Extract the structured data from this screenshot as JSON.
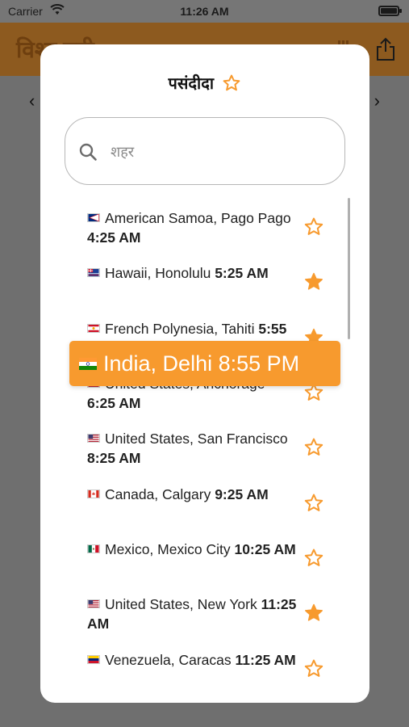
{
  "status_bar": {
    "carrier": "Carrier",
    "time": "11:26 AM"
  },
  "app_bar": {
    "title": "विश्व घड़ी"
  },
  "modal": {
    "title": "पसंदीदा",
    "search": {
      "placeholder": "शहर",
      "value": ""
    }
  },
  "cities": [
    {
      "location": "American Samoa, Pago Pago",
      "time": "4:25 AM",
      "favorite": false,
      "flag": "american-samoa"
    },
    {
      "location": "Hawaii, Honolulu",
      "time": "5:25 AM",
      "favorite": true,
      "flag": "hawaii"
    },
    {
      "location": "French Polynesia, Tahiti",
      "time": "5:55 AM",
      "favorite": true,
      "flag": "french-polynesia"
    },
    {
      "location": "United States, Anchorage",
      "time": "6:25 AM",
      "favorite": false,
      "flag": "usa"
    },
    {
      "location": "United States, San Francisco",
      "time": "8:25 AM",
      "favorite": false,
      "flag": "usa"
    },
    {
      "location": "Canada, Calgary",
      "time": "9:25 AM",
      "favorite": false,
      "flag": "canada"
    },
    {
      "location": "Mexico, Mexico City",
      "time": "10:25 AM",
      "favorite": false,
      "flag": "mexico"
    },
    {
      "location": "United States, New York",
      "time": "11:25 AM",
      "favorite": true,
      "flag": "usa"
    },
    {
      "location": "Venezuela, Caracas",
      "time": "11:25 AM",
      "favorite": false,
      "flag": "venezuela"
    }
  ],
  "toast": {
    "text": "India, Delhi 8:55 PM",
    "flag": "india"
  },
  "colors": {
    "accent": "#f79a2e",
    "star": "#f79a2e"
  }
}
